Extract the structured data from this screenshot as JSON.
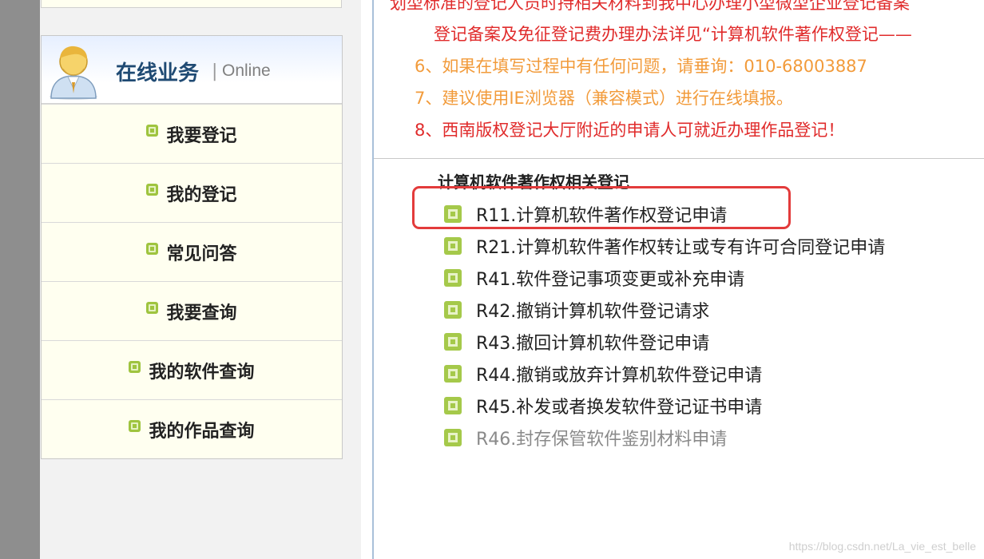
{
  "sidebar": {
    "header_title": "在线业务",
    "header_separator": "|",
    "header_subtitle": "Online",
    "items": [
      {
        "label": "我要登记"
      },
      {
        "label": "我的登记"
      },
      {
        "label": "常见问答"
      },
      {
        "label": "我要查询"
      },
      {
        "label": "我的软件查询"
      },
      {
        "label": "我的作品查询"
      }
    ]
  },
  "notices": {
    "line_top": "划型标准的登记人员时持相关材料到我中心办理小型微型企业登记备案",
    "line_2": "登记备案及免征登记费办理办法详见“计算机软件著作权登记——",
    "line_6": "6、如果在填写过程中有任何问题，请垂询：010-68003887",
    "line_7": "7、建议使用IE浏览器（兼容模式）进行在线填报。",
    "line_8": "8、西南版权登记大厅附近的申请人可就近办理作品登记！"
  },
  "section": {
    "title": "计算机软件著作权相关登记",
    "applications": [
      {
        "label": "R11.计算机软件著作权登记申请",
        "enabled": true
      },
      {
        "label": "R21.计算机软件著作权转让或专有许可合同登记申请",
        "enabled": true
      },
      {
        "label": "R41.软件登记事项变更或补充申请",
        "enabled": true
      },
      {
        "label": "R42.撤销计算机软件登记请求",
        "enabled": true
      },
      {
        "label": "R43.撤回计算机软件登记申请",
        "enabled": true
      },
      {
        "label": "R44.撤销或放弃计算机软件登记申请",
        "enabled": true
      },
      {
        "label": "R45.补发或者换发软件登记证书申请",
        "enabled": true
      },
      {
        "label": "R46.封存保管软件鉴别材料申请",
        "enabled": false
      }
    ]
  },
  "watermark": "https://blog.csdn.net/La_vie_est_belle",
  "colors": {
    "notice_red": "#e02b2b",
    "notice_orange": "#f29b3b",
    "highlight_red": "#e33b3b",
    "bullet_green": "#9fc43f",
    "header_blue": "#1f4a73"
  }
}
